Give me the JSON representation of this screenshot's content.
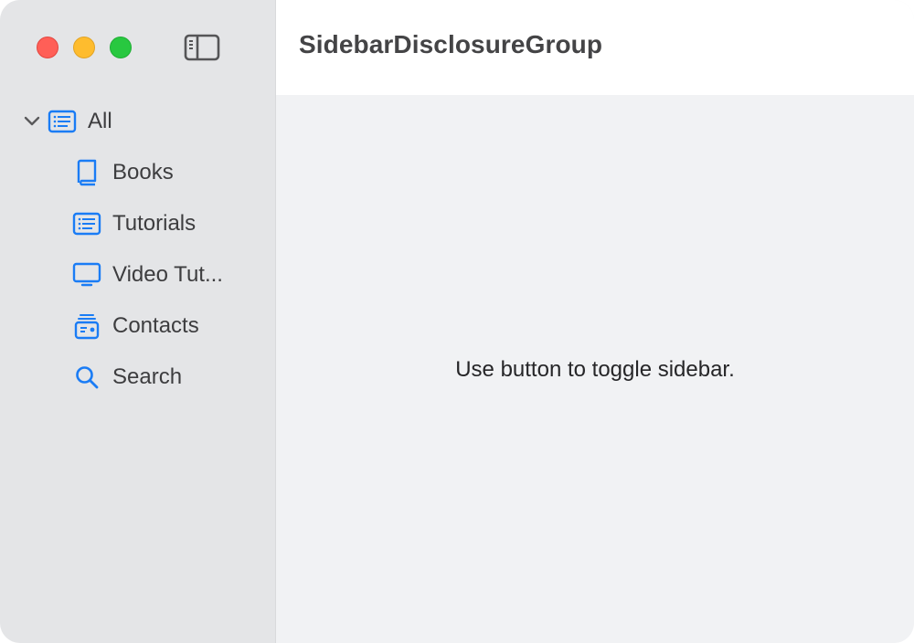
{
  "window": {
    "controls": [
      {
        "name": "close",
        "color": "#ff5f57"
      },
      {
        "name": "minimize",
        "color": "#febc2e"
      },
      {
        "name": "zoom",
        "color": "#28c840"
      }
    ],
    "toggle_icon": "sidebar-left-icon"
  },
  "toolbar": {
    "title": "SidebarDisclosureGroup"
  },
  "sidebar": {
    "accent_color": "#1a7cf5",
    "group": {
      "label": "All",
      "icon": "list-bullet-rectangle-icon",
      "expanded": true,
      "chevron_icon": "chevron-down-icon"
    },
    "items": [
      {
        "label": "Books",
        "icon": "book-icon"
      },
      {
        "label": "Tutorials",
        "icon": "list-bullet-rectangle-icon"
      },
      {
        "label": "Video Tut...",
        "icon": "display-icon"
      },
      {
        "label": "Contacts",
        "icon": "contacts-card-stack-icon"
      },
      {
        "label": "Search",
        "icon": "magnifyingglass-icon"
      }
    ]
  },
  "content": {
    "message": "Use button to toggle sidebar."
  }
}
